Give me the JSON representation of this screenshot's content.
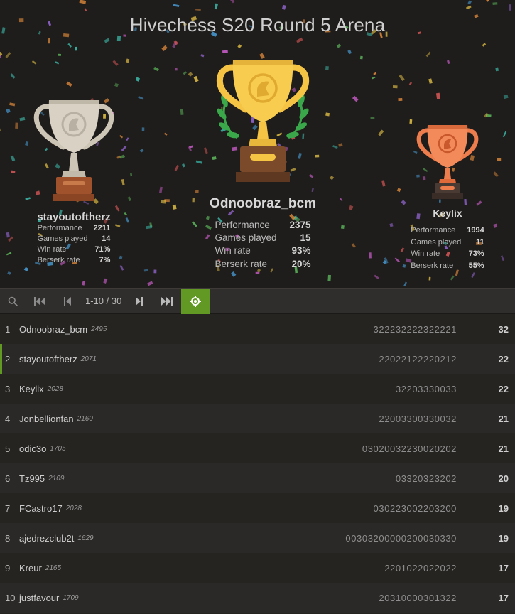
{
  "tournament": {
    "title": "Hivechess S20 Round 5 Arena"
  },
  "podium": {
    "stat_labels": {
      "performance": "Performance",
      "games": "Games played",
      "win": "Win rate",
      "berserk": "Berserk rate"
    },
    "first": {
      "name": "Odnoobraz_bcm",
      "performance": "2375",
      "games": "15",
      "win": "93%",
      "berserk": "20%"
    },
    "second": {
      "name": "stayoutoftherz",
      "performance": "2211",
      "games": "14",
      "win": "71%",
      "berserk": "7%"
    },
    "third": {
      "name": "Keylix",
      "performance": "1994",
      "games": "11",
      "win": "73%",
      "berserk": "55%"
    }
  },
  "pager": {
    "range": "1-10 / 30"
  },
  "icons": {
    "search": "search-icon",
    "first": "first-page-icon",
    "prev": "previous-page-icon",
    "next": "next-page-icon",
    "last": "last-page-icon",
    "me": "target-icon"
  },
  "colors": {
    "accent": "#629924",
    "gold": "#f6c445",
    "silver": "#cdc5b6",
    "bronze": "#ee7d4d"
  },
  "standings": [
    {
      "rank": "1",
      "name": "Odnoobraz_bcm",
      "rating": "2495",
      "sheet": "322232222322221",
      "score": "32"
    },
    {
      "rank": "2",
      "name": "stayoutoftherz",
      "rating": "2071",
      "sheet": "22022122220212",
      "score": "22"
    },
    {
      "rank": "3",
      "name": "Keylix",
      "rating": "2028",
      "sheet": "32203330033",
      "score": "22"
    },
    {
      "rank": "4",
      "name": "Jonbellionfan",
      "rating": "2160",
      "sheet": "22003300330032",
      "score": "21"
    },
    {
      "rank": "5",
      "name": "odic3o",
      "rating": "1705",
      "sheet": "03020032230020202",
      "score": "21"
    },
    {
      "rank": "6",
      "name": "Tz995",
      "rating": "2109",
      "sheet": "03320323202",
      "score": "20"
    },
    {
      "rank": "7",
      "name": "FCastro17",
      "rating": "2028",
      "sheet": "030223002203200",
      "score": "19"
    },
    {
      "rank": "8",
      "name": "ajedrezclub2t",
      "rating": "1629",
      "sheet": "00303200000200030330",
      "score": "19"
    },
    {
      "rank": "9",
      "name": "Kreur",
      "rating": "2165",
      "sheet": "2201022022022",
      "score": "17"
    },
    {
      "rank": "10",
      "name": "justfavour",
      "rating": "1709",
      "sheet": "20310000301322",
      "score": "17"
    }
  ]
}
